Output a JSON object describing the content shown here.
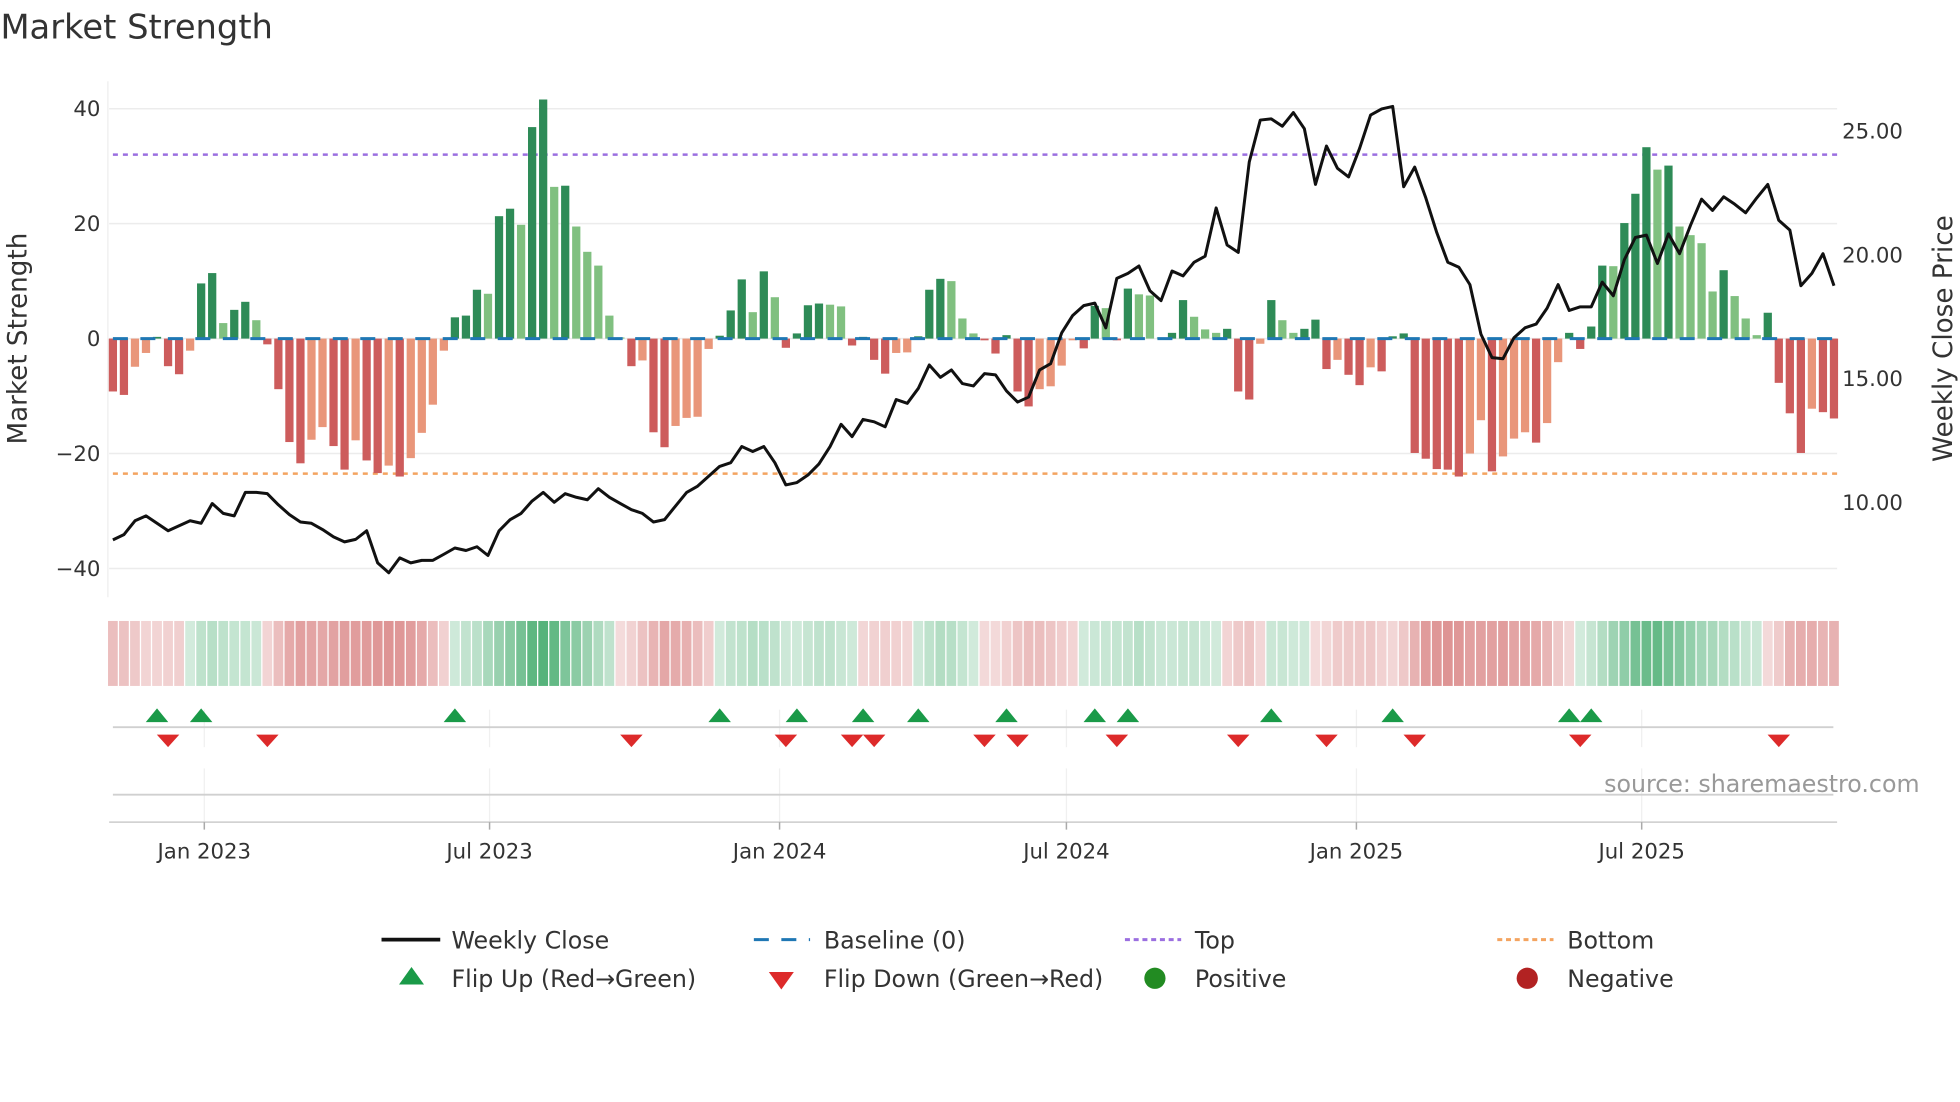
{
  "title": "Market Strength",
  "source": "source: sharemaestro.com",
  "chart_data": {
    "type": "bar",
    "title": "Market Strength",
    "frequency": "weekly",
    "start_week": "2022-11-04",
    "ylabel_left": "Market Strength",
    "ylabel_right": "Weekly Close Price",
    "ylim_left": [
      -44,
      44
    ],
    "ylim_right": [
      6.5,
      26.5
    ],
    "y_ticks_left": [
      {
        "value": 40,
        "label": "40"
      },
      {
        "value": 20,
        "label": "20"
      },
      {
        "value": 0,
        "label": "0"
      },
      {
        "value": -20,
        "label": "−20"
      },
      {
        "value": -40,
        "label": "−40"
      }
    ],
    "y_ticks_right": [
      {
        "value": 25,
        "label": "25.00"
      },
      {
        "value": 20,
        "label": "20.00"
      },
      {
        "value": 15,
        "label": "15.00"
      },
      {
        "value": 10,
        "label": "10.00"
      }
    ],
    "x_ticks": [
      {
        "label": "Jan 2023",
        "date": "2023-01-01"
      },
      {
        "label": "Jul 2023",
        "date": "2023-07-01"
      },
      {
        "label": "Jan 2024",
        "date": "2024-01-01"
      },
      {
        "label": "Jul 2024",
        "date": "2024-07-01"
      },
      {
        "label": "Jan 2025",
        "date": "2025-01-01"
      },
      {
        "label": "Jul 2025",
        "date": "2025-07-01"
      }
    ],
    "top_level": 32,
    "bottom_level": -23.5,
    "baseline": 0,
    "strength": [
      -9.2,
      -9.8,
      -4.9,
      -2.5,
      0.3,
      -4.8,
      -6.2,
      -2.1,
      9.6,
      11.4,
      2.7,
      5.0,
      6.4,
      3.2,
      -1.0,
      -8.8,
      -18,
      -21.7,
      -17.6,
      -15.4,
      -18.7,
      -22.8,
      -17.7,
      -21.2,
      -23.4,
      -22.1,
      -24,
      -20.8,
      -16.4,
      -11.5,
      -2.1,
      3.7,
      4.0,
      8.5,
      7.8,
      21.3,
      22.6,
      19.8,
      36.8,
      41.6,
      26.4,
      26.6,
      19.5,
      15.1,
      12.7,
      4.0,
      0.2,
      -4.8,
      -3.8,
      -16.3,
      -18.9,
      -15.2,
      -13.8,
      -13.6,
      -1.8,
      0.5,
      4.9,
      10.3,
      4.6,
      11.7,
      7.2,
      -1.6,
      0.9,
      5.8,
      6.1,
      5.9,
      5.6,
      -1.2,
      0.3,
      -3.7,
      -6.1,
      -2.5,
      -2.4,
      0.4,
      8.5,
      10.4,
      10.0,
      3.5,
      0.9,
      -0.3,
      -2.6,
      0.6,
      -9.2,
      -11.8,
      -8.8,
      -8.3,
      -4.7,
      -0.3,
      -1.7,
      5.7,
      5.3,
      -0.3,
      8.7,
      7.7,
      7.5,
      0.2,
      1.0,
      6.7,
      3.8,
      1.6,
      1.0,
      1.7,
      -9.2,
      -10.6,
      -0.9,
      6.7,
      3.2,
      1.0,
      1.7,
      3.3,
      -5.3,
      -3.7,
      -6.3,
      -8.1,
      -5.0,
      -5.7,
      0.4,
      0.9,
      -19.9,
      -20.9,
      -22.7,
      -22.8,
      -24,
      -20,
      -14.2,
      -23.1,
      -20.5,
      -17.4,
      -16.3,
      -18.1,
      -14.7,
      -4.1,
      1.0,
      -1.8,
      2.1,
      12.7,
      12.6,
      20.1,
      25.2,
      33.3,
      29.4,
      30.1,
      19.5,
      18.0,
      16.6,
      8.2,
      11.9,
      7.4,
      3.5,
      0.6,
      4.5,
      -7.7,
      -13.0,
      -19.9,
      -12.2,
      -12.8,
      -13.9
    ],
    "weekly_close": [
      8.43,
      8.64,
      9.2,
      9.4,
      9.1,
      8.8,
      9.0,
      9.2,
      9.1,
      9.9,
      9.5,
      9.4,
      10.35,
      10.35,
      10.3,
      9.85,
      9.45,
      9.15,
      9.1,
      8.85,
      8.55,
      8.35,
      8.45,
      8.8,
      7.5,
      7.1,
      7.7,
      7.5,
      7.6,
      7.6,
      7.85,
      8.1,
      8.0,
      8.15,
      7.8,
      8.8,
      9.25,
      9.5,
      10.0,
      10.35,
      9.95,
      10.3,
      10.15,
      10.05,
      10.5,
      10.15,
      9.9,
      9.65,
      9.5,
      9.15,
      9.25,
      9.8,
      10.35,
      10.6,
      11.0,
      11.4,
      11.55,
      12.2,
      12.0,
      12.2,
      11.55,
      10.65,
      10.75,
      11.05,
      11.5,
      12.2,
      13.1,
      12.6,
      13.3,
      13.2,
      13.0,
      14.1,
      13.95,
      14.55,
      15.5,
      15.0,
      15.3,
      14.75,
      14.65,
      15.15,
      15.1,
      14.45,
      14.0,
      14.2,
      15.3,
      15.55,
      16.8,
      17.5,
      17.9,
      18.0,
      17.0,
      19.0,
      19.2,
      19.5,
      18.5,
      18.1,
      19.3,
      19.1,
      19.65,
      19.9,
      21.85,
      20.35,
      20.05,
      23.7,
      25.4,
      25.45,
      25.15,
      25.7,
      25.05,
      22.8,
      24.35,
      23.45,
      23.1,
      24.25,
      25.6,
      25.85,
      25.95,
      22.7,
      23.5,
      22.25,
      20.85,
      19.65,
      19.45,
      18.75,
      16.75,
      15.8,
      15.75,
      16.6,
      17.0,
      17.15,
      17.8,
      18.75,
      17.7,
      17.85,
      17.85,
      18.85,
      18.3,
      19.75,
      20.65,
      20.75,
      19.6,
      20.8,
      20.0,
      21.15,
      22.2,
      21.75,
      22.3,
      22.0,
      21.65,
      22.25,
      22.8,
      21.35,
      20.95,
      18.7,
      19.2,
      20.0,
      18.7
    ],
    "flip_up_weeks": [
      4,
      8,
      31,
      55,
      62,
      68,
      73,
      81,
      89,
      92,
      105,
      116,
      132,
      134
    ],
    "flip_down_weeks": [
      5,
      14,
      47,
      61,
      67,
      69,
      79,
      82,
      91,
      102,
      110,
      118,
      133,
      151
    ],
    "legend": {
      "placement": "bottom",
      "items": [
        {
          "key": "close",
          "label": "Weekly Close"
        },
        {
          "key": "baseline",
          "label": "Baseline (0)"
        },
        {
          "key": "top",
          "label": "Top"
        },
        {
          "key": "bottom",
          "label": "Bottom"
        },
        {
          "key": "flip_up",
          "label": "Flip Up (Red→Green)"
        },
        {
          "key": "flip_down",
          "label": "Flip Down (Green→Red)"
        },
        {
          "key": "positive",
          "label": "Positive"
        },
        {
          "key": "negative",
          "label": "Negative"
        }
      ]
    },
    "colors": {
      "pos_strong": "#2e8b57",
      "pos_weak": "#80c080",
      "neg_strong": "#cd5c5c",
      "neg_weak": "#e9967a",
      "close": "#111111",
      "baseline": "#1f77b4",
      "top": "#9b6fe0",
      "bottom": "#f4a460",
      "flip_up": "#1a9a48",
      "flip_down": "#dd2a2a",
      "positive": "#228b22",
      "negative": "#b22222"
    }
  }
}
